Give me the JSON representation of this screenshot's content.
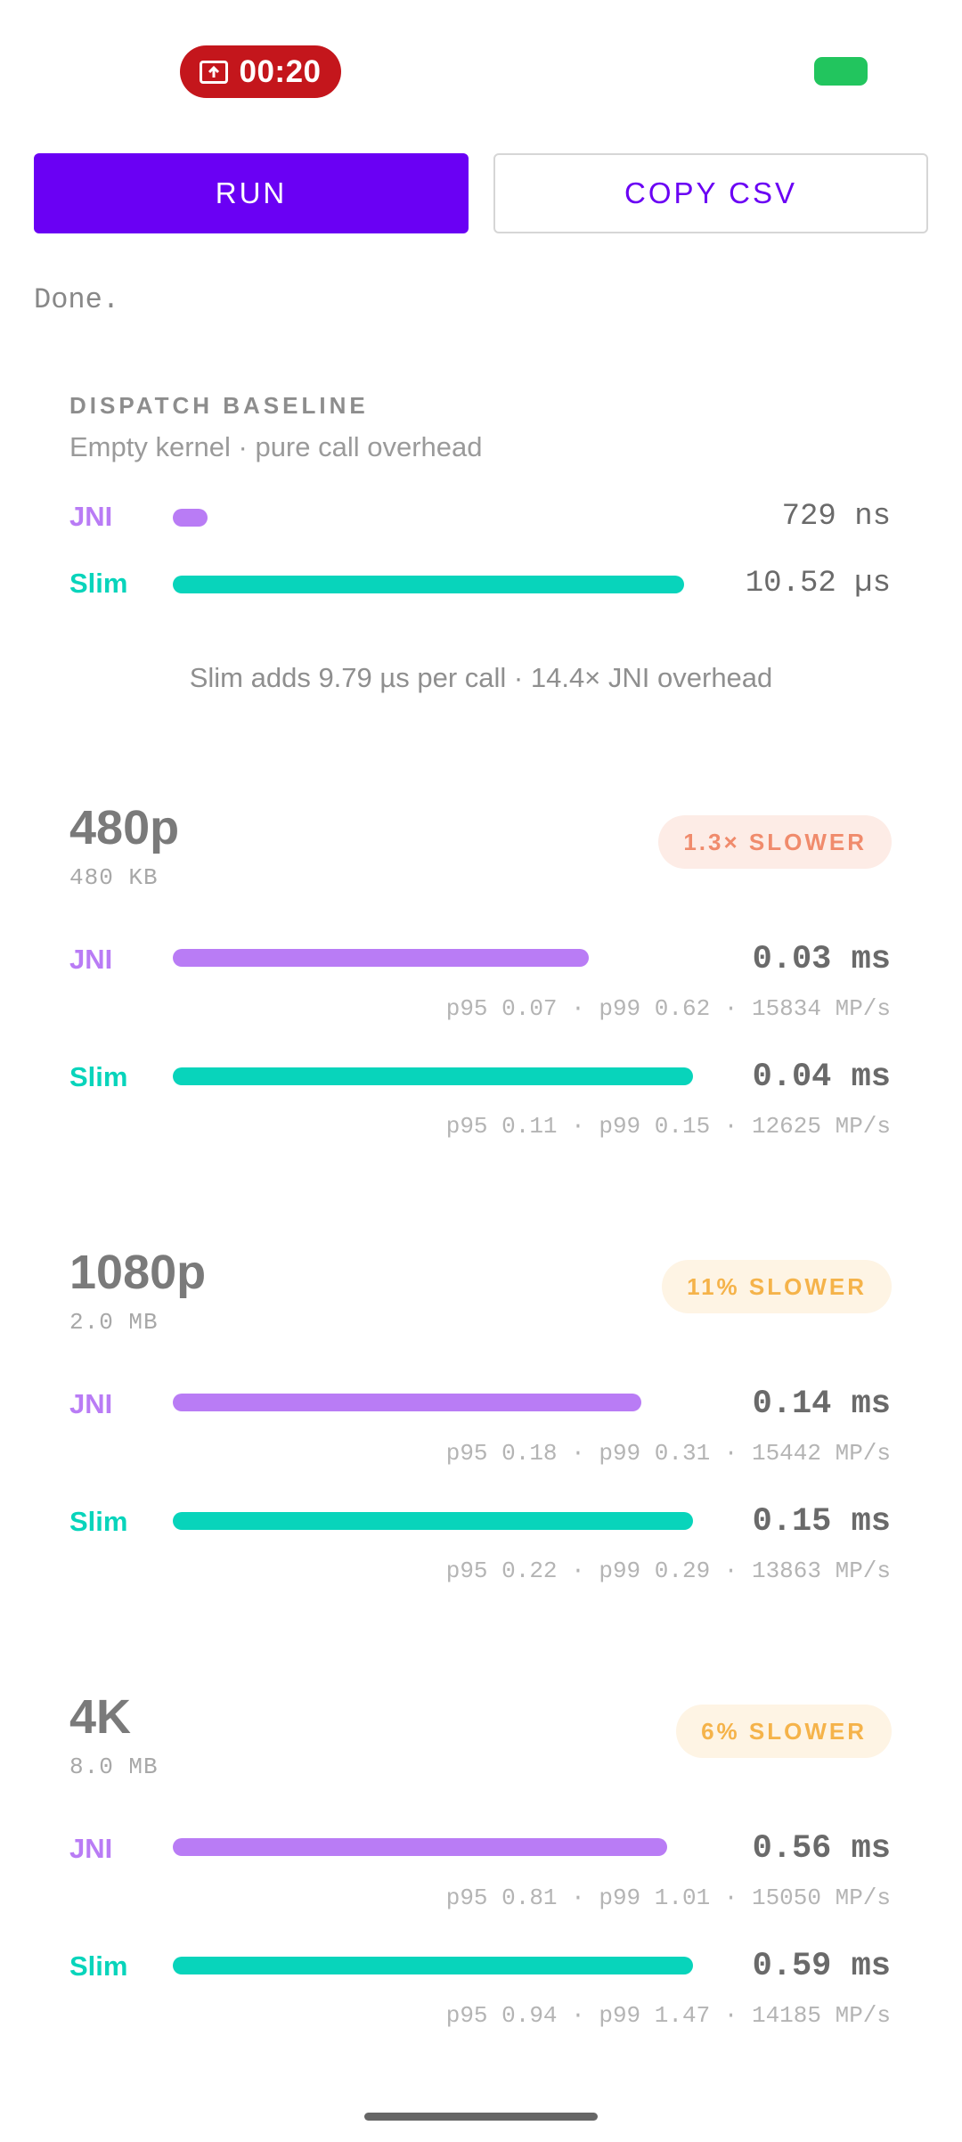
{
  "status_bar": {
    "record_time": "00:20",
    "record_icon": "screen-record-icon",
    "battery_icon": "battery-icon",
    "battery_color": "#22c55e"
  },
  "toolbar": {
    "run_label": "RUN",
    "copy_csv_label": "COPY CSV",
    "accent_color": "#6a00f4"
  },
  "status_text": "Done.",
  "baseline": {
    "label": "DISPATCH BASELINE",
    "subtitle": "Empty kernel · pure call overhead",
    "jni_label": "JNI",
    "jni_value": "729 ns",
    "jni_level": 0.068,
    "slim_label": "Slim",
    "slim_value": "10.52 µs",
    "slim_level": 1.0,
    "summary": "Slim adds 9.79 µs per call · 14.4× JNI overhead"
  },
  "results": [
    {
      "title": "480p",
      "size": "480 KB",
      "badge": "1.3× SLOWER",
      "jni_label": "JNI",
      "jni_value": "0.03 ms",
      "jni_stats": "p95 0.07 · p99 0.62 · 15834 MP/s",
      "jni_level": 0.8,
      "slim_label": "Slim",
      "slim_value": "0.04 ms",
      "slim_stats": "p95 0.11 · p99 0.15 · 12625 MP/s",
      "slim_level": 1.0
    },
    {
      "title": "1080p",
      "size": "2.0 MB",
      "badge": "11% SLOWER",
      "jni_label": "JNI",
      "jni_value": "0.14 ms",
      "jni_stats": "p95 0.18 · p99 0.31 · 15442 MP/s",
      "jni_level": 0.9,
      "slim_label": "Slim",
      "slim_value": "0.15 ms",
      "slim_stats": "p95 0.22 · p99 0.29 · 13863 MP/s",
      "slim_level": 1.0
    },
    {
      "title": "4K",
      "size": "8.0 MB",
      "badge": "6% SLOWER",
      "jni_label": "JNI",
      "jni_value": "0.56 ms",
      "jni_stats": "p95 0.81 · p99 1.01 · 15050 MP/s",
      "jni_level": 0.95,
      "slim_label": "Slim",
      "slim_value": "0.59 ms",
      "slim_stats": "p95 0.94 · p99 1.47 · 14185 MP/s",
      "slim_level": 1.0
    }
  ]
}
